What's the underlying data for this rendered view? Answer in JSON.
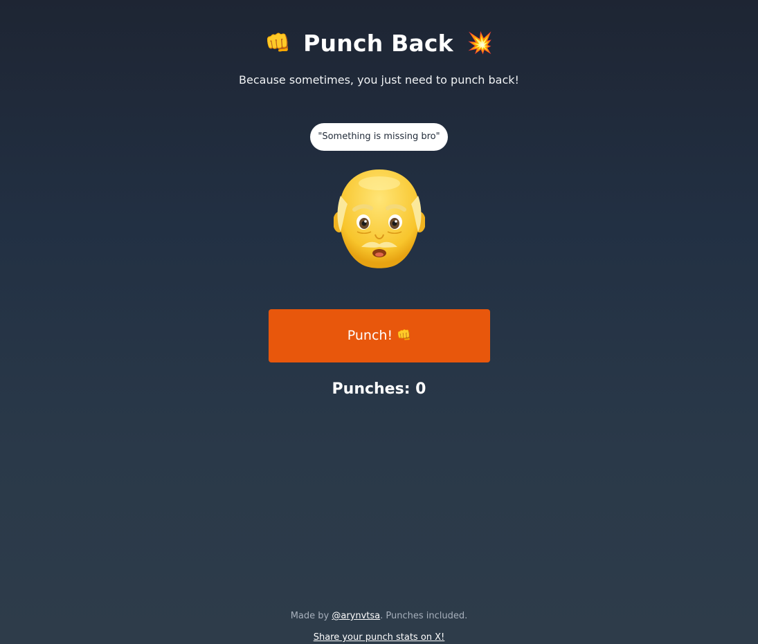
{
  "header": {
    "title": "Punch Back",
    "title_icon_left": "oncoming-fist-icon",
    "title_icon_left_glyph": "👊",
    "title_icon_right": "collision-icon",
    "title_icon_right_glyph": "💥",
    "subtitle": "Because sometimes, you just need to punch back!"
  },
  "target": {
    "quote": "\"Something is missing bro\"",
    "face_icon": "older-man-emoji-icon"
  },
  "controls": {
    "punch_label": "Punch!",
    "punch_icon": "oncoming-fist-icon",
    "punch_icon_glyph": "👊",
    "accent_color": "#e8570c"
  },
  "stats": {
    "counter_label": "Punches: 0",
    "punches": 0
  },
  "footer": {
    "made_by_prefix": "Made by ",
    "author_link": "@arynvtsa",
    "made_by_suffix": ". Punches included.",
    "share_link": "Share your punch stats on X!"
  }
}
